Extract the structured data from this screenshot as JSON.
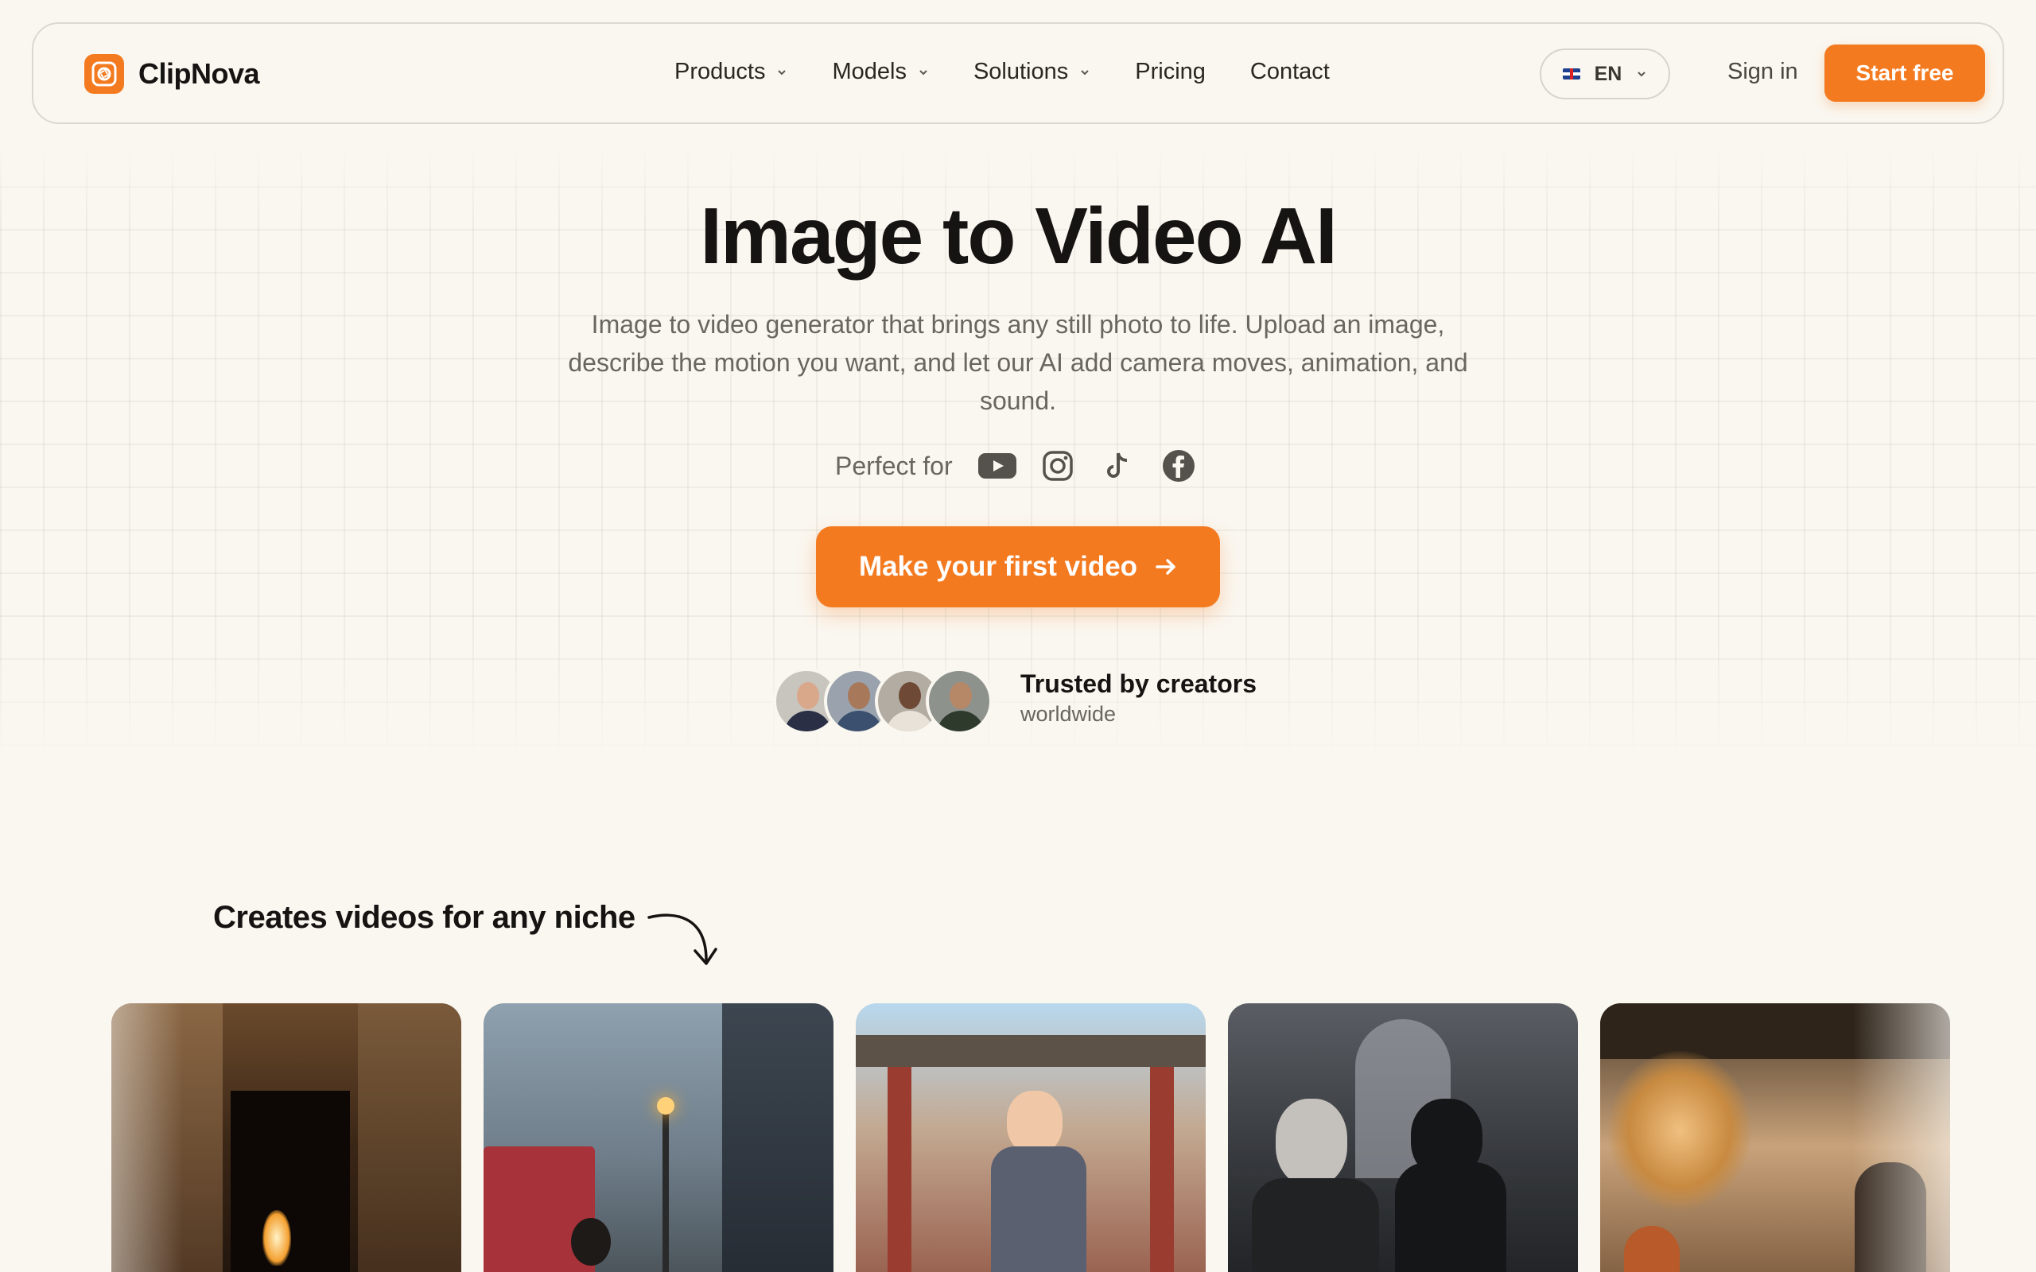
{
  "brand": {
    "name": "ClipNova",
    "accent": "#f47a20"
  },
  "nav": {
    "menu": [
      {
        "label": "Products",
        "dropdown": true
      },
      {
        "label": "Models",
        "dropdown": true
      },
      {
        "label": "Solutions",
        "dropdown": true
      },
      {
        "label": "Pricing",
        "dropdown": false
      },
      {
        "label": "Contact",
        "dropdown": false
      }
    ],
    "language": "EN",
    "sign_in": "Sign in",
    "start_free": "Start free"
  },
  "hero": {
    "title": "Image to Video AI",
    "subtitle": "Image to video generator that brings any still photo to life. Upload an image, describe the motion you want, and let our AI add camera moves, animation, and sound.",
    "perfect_for": "Perfect for",
    "platforms": [
      "youtube-icon",
      "instagram-icon",
      "tiktok-icon",
      "facebook-icon"
    ],
    "cta": "Make your first video",
    "trust_title": "Trusted by creators",
    "trust_sub": "worldwide"
  },
  "niche": {
    "title": "Creates videos for any niche",
    "cards": [
      "tomb-scene",
      "rainy-street-scene",
      "anime-temple-scene",
      "gothic-storm-scene",
      "train-station-scene"
    ]
  }
}
